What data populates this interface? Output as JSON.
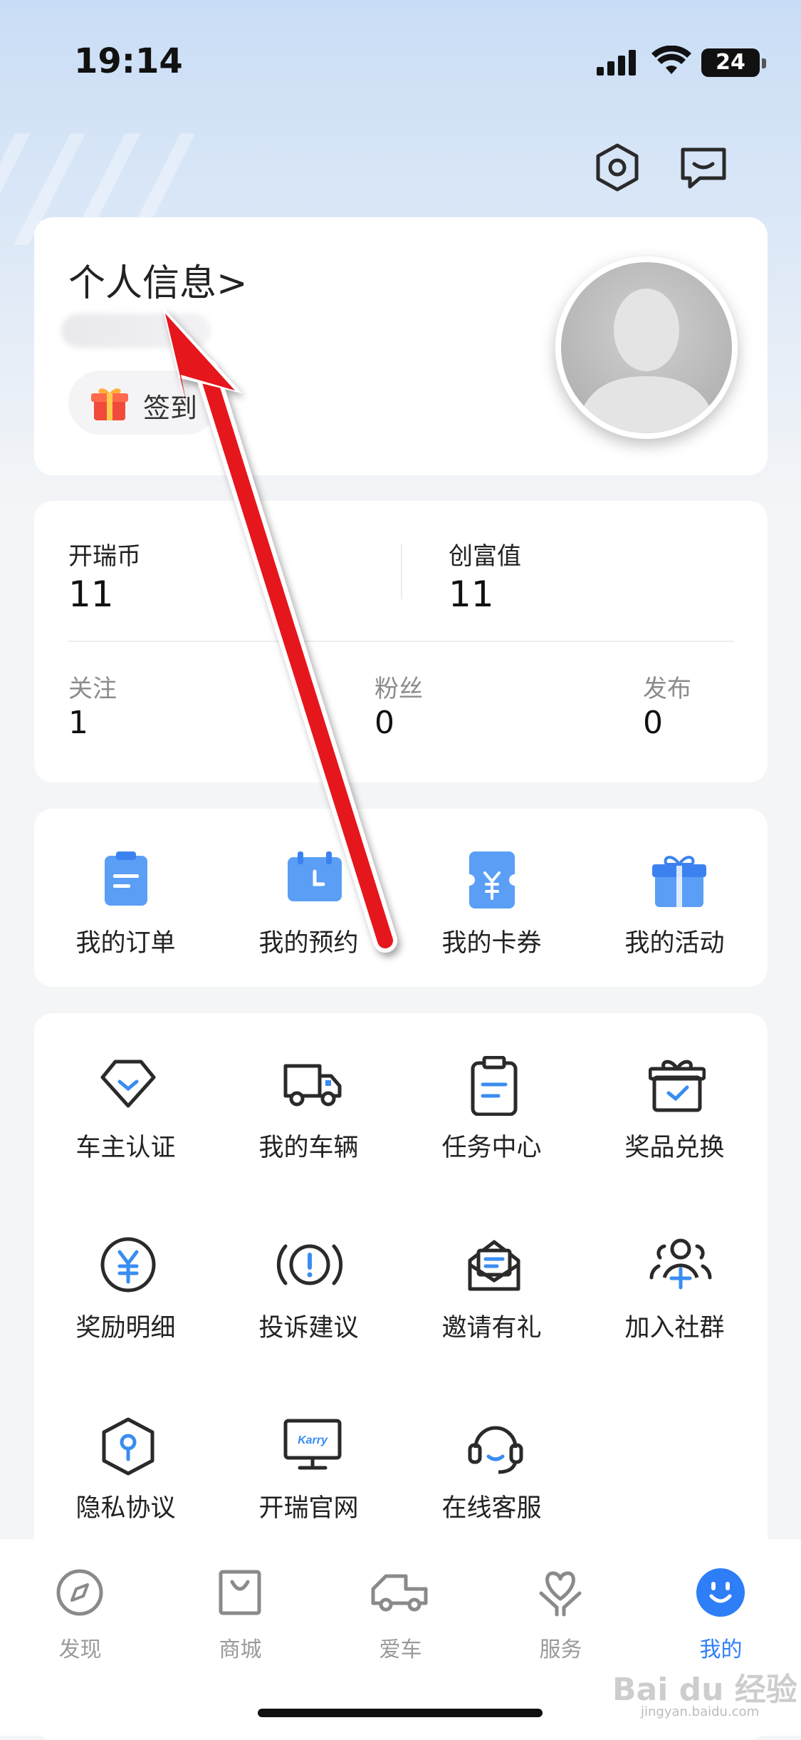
{
  "status_bar": {
    "time": "19:14",
    "battery": "24"
  },
  "profile": {
    "title": "个人信息>",
    "signin_label": "签到"
  },
  "stats": {
    "top": [
      {
        "label": "开瑞币",
        "value": "11"
      },
      {
        "label": "创富值",
        "value": "11"
      }
    ],
    "bottom": [
      {
        "label": "关注",
        "value": "1"
      },
      {
        "label": "粉丝",
        "value": "0"
      },
      {
        "label": "发布",
        "value": "0"
      }
    ]
  },
  "quick_actions": [
    {
      "label": "我的订单",
      "icon": "order-icon"
    },
    {
      "label": "我的预约",
      "icon": "calendar-icon"
    },
    {
      "label": "我的卡券",
      "icon": "coupon-icon"
    },
    {
      "label": "我的活动",
      "icon": "gift-icon"
    }
  ],
  "services": [
    {
      "label": "车主认证",
      "icon": "diamond-icon"
    },
    {
      "label": "我的车辆",
      "icon": "truck-icon"
    },
    {
      "label": "任务中心",
      "icon": "clipboard-icon"
    },
    {
      "label": "奖品兑换",
      "icon": "prize-box-icon"
    },
    {
      "label": "奖励明细",
      "icon": "yuan-coin-icon"
    },
    {
      "label": "投诉建议",
      "icon": "alert-icon"
    },
    {
      "label": "邀请有礼",
      "icon": "mail-icon"
    },
    {
      "label": "加入社群",
      "icon": "group-add-icon"
    },
    {
      "label": "隐私协议",
      "icon": "privacy-icon"
    },
    {
      "label": "开瑞官网",
      "icon": "monitor-icon",
      "brand_text": "Karry"
    },
    {
      "label": "在线客服",
      "icon": "headset-icon"
    }
  ],
  "tabbar": [
    {
      "label": "发现",
      "icon": "compass-icon",
      "active": false
    },
    {
      "label": "商城",
      "icon": "shop-bag-icon",
      "active": false
    },
    {
      "label": "爱车",
      "icon": "car-icon",
      "active": false
    },
    {
      "label": "服务",
      "icon": "heart-hand-icon",
      "active": false
    },
    {
      "label": "我的",
      "icon": "smile-icon",
      "active": true
    }
  ],
  "watermark": {
    "main": "Bai du 经验",
    "sub": "jingyan.baidu.com"
  },
  "colors": {
    "accent": "#2d7ef7",
    "arrow": "#e5121b"
  }
}
